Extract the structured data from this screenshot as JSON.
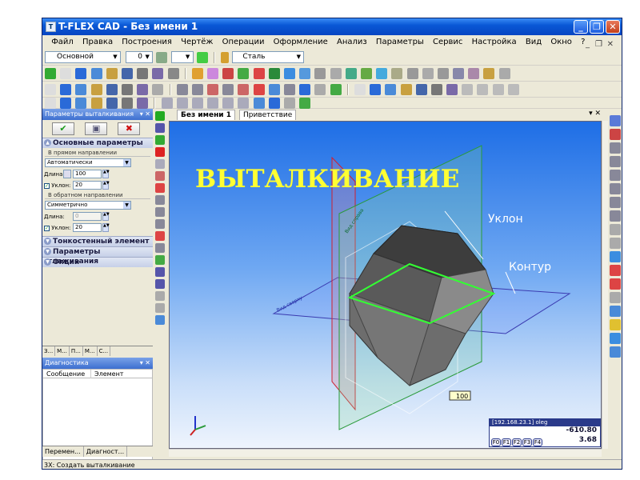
{
  "window": {
    "title": "T-FLEX CAD - Без имени 1",
    "app_icon": "T"
  },
  "menu": [
    "Файл",
    "Правка",
    "Построения",
    "Чертёж",
    "Операции",
    "Оформление",
    "Анализ",
    "Параметры",
    "Сервис",
    "Настройка",
    "Вид",
    "Окно",
    "?"
  ],
  "toolbar": {
    "layer_value": "Основной",
    "level_value": "0",
    "material_value": "Сталь"
  },
  "panel": {
    "title": "Параметры выталкивания",
    "sections": {
      "main": "Основные параметры",
      "thin": "Тонкостенный элемент",
      "smooth": "Параметры сглаживания",
      "options": "Опции"
    },
    "forward": {
      "group": "В прямом направлении",
      "mode": "Автоматически",
      "length_label": "Длина:",
      "length_value": "100",
      "draft_label": "Уклон:",
      "draft_value": "20"
    },
    "backward": {
      "group": "В обратном направлении",
      "mode": "Симметрично",
      "length_label": "Длина:",
      "length_value": "0",
      "draft_label": "Уклон:",
      "draft_value": "20"
    },
    "tabs": [
      "З...",
      "М...",
      "П...",
      "М...",
      "С..."
    ]
  },
  "diagnostics": {
    "title": "Диагностика",
    "col1": "Сообщение",
    "col2": "Элемент"
  },
  "bottom_tabs": [
    "Перемен...",
    "Диагност..."
  ],
  "document": {
    "tab1": "Без имени 1",
    "tab2": "Приветствие"
  },
  "canvas": {
    "heading": "ВЫТАЛКИВАНИЕ",
    "label_draft": "Уклон",
    "label_contour": "Контур",
    "dimension": "100",
    "accent": "#ffff33"
  },
  "coords": {
    "title": "[192.168.23.1] oleg",
    "value1": "-610.80",
    "value2": "3.68",
    "fkeys": [
      "F0",
      "F1",
      "F2",
      "F3",
      "F4"
    ]
  },
  "status": "3Х: Создать выталкивание"
}
